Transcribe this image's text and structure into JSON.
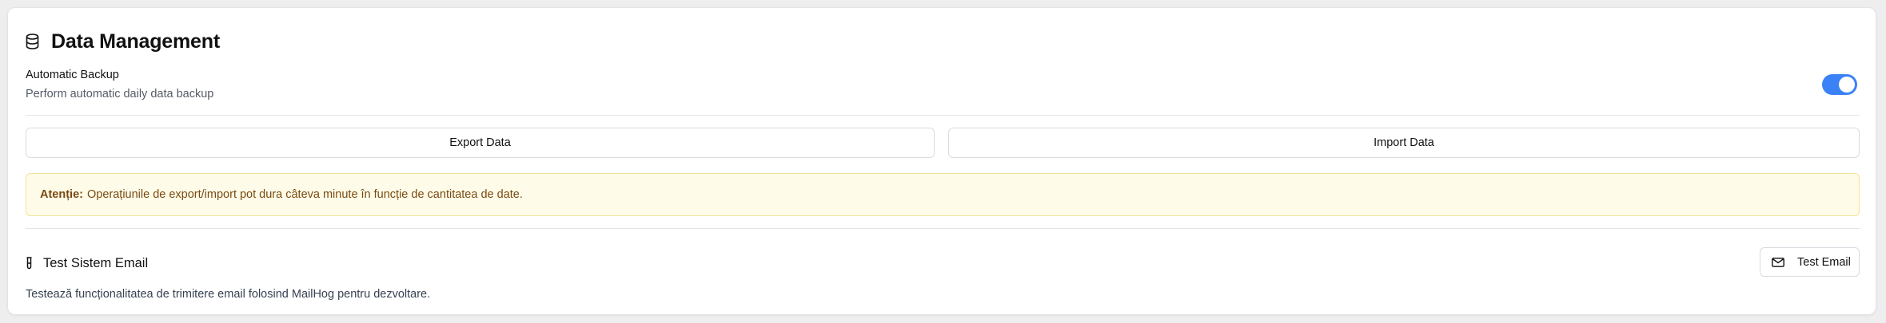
{
  "section": {
    "title": "Data Management",
    "icon": "database-icon"
  },
  "backup": {
    "title": "Automatic Backup",
    "description": "Perform automatic daily data backup",
    "enabled": true,
    "toggle_color": "#3b82f6"
  },
  "actions": {
    "export_label": "Export Data",
    "import_label": "Import Data"
  },
  "alert": {
    "label": "Atenție:",
    "message": "Operațiunile de export/import pot dura câteva minute în funcție de cantitatea de date.",
    "background": "#fefce8",
    "text_color": "#7a4a12"
  },
  "email_test": {
    "title": "Test Sistem Email",
    "icon": "test-tube-icon",
    "description": "Testează funcționalitatea de trimitere email folosind MailHog pentru dezvoltare.",
    "button_label": "Test Email",
    "button_icon": "mail-icon"
  }
}
